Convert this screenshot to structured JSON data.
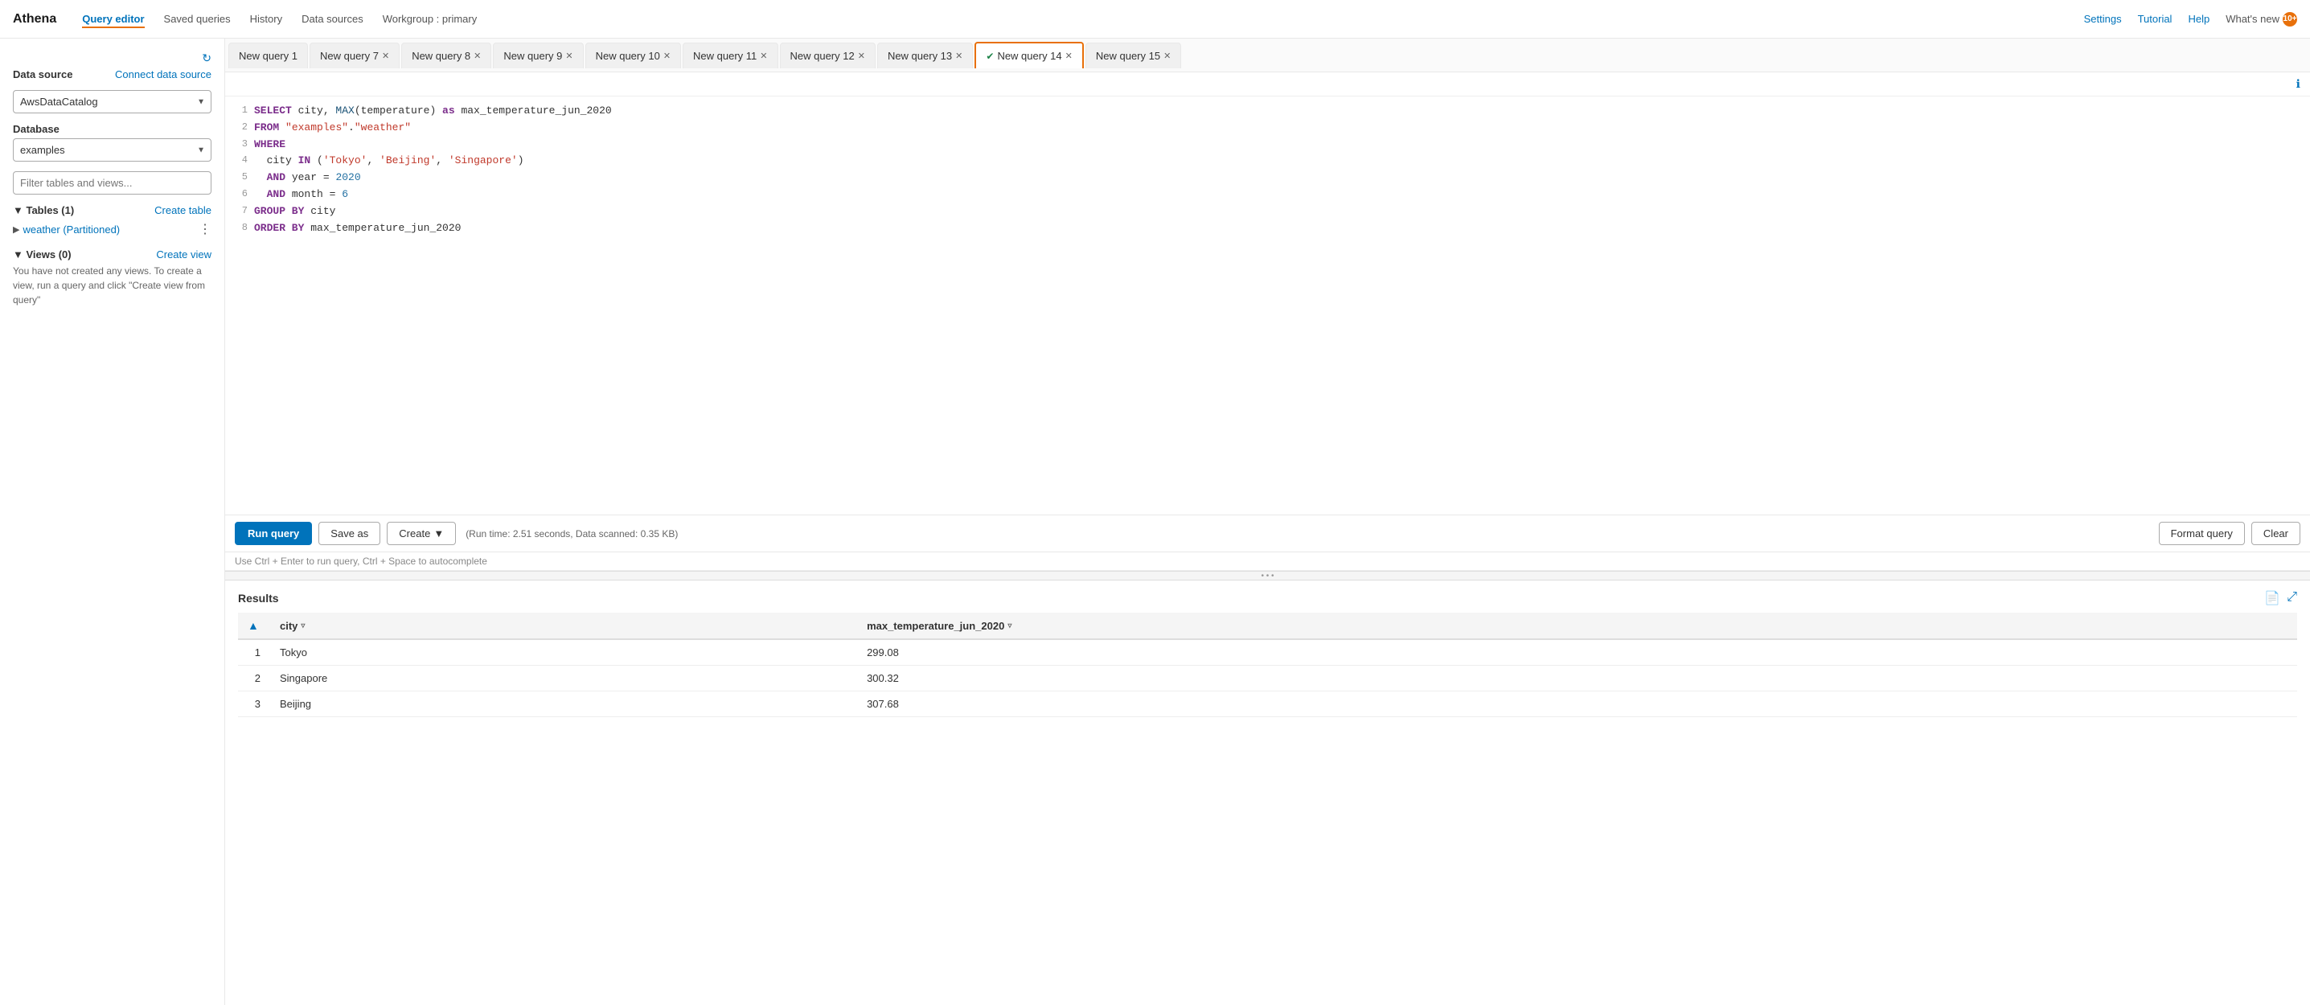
{
  "app": {
    "logo": "Athena",
    "nav_items": [
      {
        "label": "Query editor",
        "active": true
      },
      {
        "label": "Saved queries",
        "active": false
      },
      {
        "label": "History",
        "active": false
      },
      {
        "label": "Data sources",
        "active": false
      },
      {
        "label": "Workgroup : primary",
        "active": false
      }
    ],
    "nav_right": [
      {
        "label": "Settings"
      },
      {
        "label": "Tutorial"
      },
      {
        "label": "Help"
      },
      {
        "label": "What's new",
        "badge": "10+"
      }
    ]
  },
  "sidebar": {
    "title": "Data source",
    "connect_label": "Connect data source",
    "datasource_options": [
      "AwsDataCatalog"
    ],
    "datasource_selected": "AwsDataCatalog",
    "database_label": "Database",
    "database_options": [
      "examples"
    ],
    "database_selected": "examples",
    "filter_placeholder": "Filter tables and views...",
    "tables_section": {
      "title": "Tables (1)",
      "action": "Create table",
      "items": [
        {
          "name": "weather (Partitioned)"
        }
      ]
    },
    "views_section": {
      "title": "Views (0)",
      "action": "Create view",
      "empty_text": "You have not created any views. To create a view, run a query and click \"Create view from query\""
    }
  },
  "tabs": [
    {
      "label": "New query 1",
      "closeable": false,
      "active": false
    },
    {
      "label": "New query 7",
      "closeable": true,
      "active": false
    },
    {
      "label": "New query 8",
      "closeable": true,
      "active": false
    },
    {
      "label": "New query 9",
      "closeable": true,
      "active": false
    },
    {
      "label": "New query 10",
      "closeable": true,
      "active": false
    },
    {
      "label": "New query 11",
      "closeable": true,
      "active": false
    },
    {
      "label": "New query 12",
      "closeable": true,
      "active": false
    },
    {
      "label": "New query 13",
      "closeable": true,
      "active": false
    },
    {
      "label": "New query 14",
      "closeable": true,
      "active": true,
      "success": true
    },
    {
      "label": "New query 15",
      "closeable": true,
      "active": false
    }
  ],
  "editor": {
    "lines": [
      {
        "num": 1,
        "code": "SELECT city, MAX(temperature) as max_temperature_jun_2020"
      },
      {
        "num": 2,
        "code": "FROM \"examples\".\"weather\""
      },
      {
        "num": 3,
        "code": "WHERE"
      },
      {
        "num": 4,
        "code": "  city IN ('Tokyo', 'Beijing', 'Singapore')"
      },
      {
        "num": 5,
        "code": "  AND year = 2020"
      },
      {
        "num": 6,
        "code": "  AND month = 6"
      },
      {
        "num": 7,
        "code": "GROUP BY city"
      },
      {
        "num": 8,
        "code": "ORDER BY max_temperature_jun_2020"
      }
    ]
  },
  "toolbar": {
    "run_label": "Run query",
    "save_label": "Save as",
    "create_label": "Create",
    "run_info": "(Run time: 2.51 seconds, Data scanned: 0.35 KB)",
    "format_label": "Format query",
    "clear_label": "Clear",
    "hint": "Use Ctrl + Enter to run query, Ctrl + Space to autocomplete"
  },
  "results": {
    "title": "Results",
    "columns": [
      {
        "label": "city",
        "sortable": true
      },
      {
        "label": "max_temperature_jun_2020",
        "sortable": true
      }
    ],
    "rows": [
      {
        "num": 1,
        "city": "Tokyo",
        "max_temp": "299.08"
      },
      {
        "num": 2,
        "city": "Singapore",
        "max_temp": "300.32"
      },
      {
        "num": 3,
        "city": "Beijing",
        "max_temp": "307.68"
      }
    ]
  }
}
